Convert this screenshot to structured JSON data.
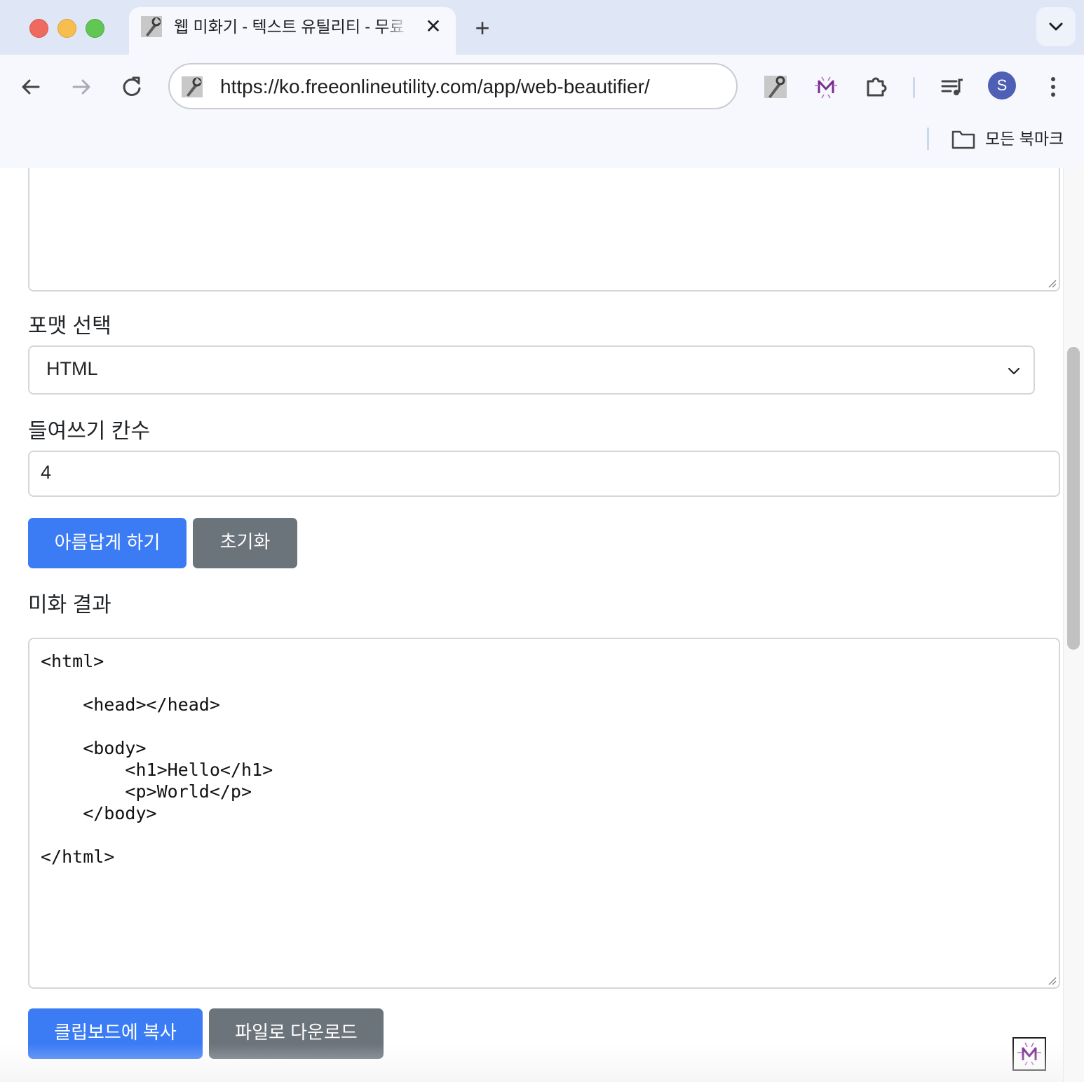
{
  "browser": {
    "tab": {
      "title": "웹 미화기 - 텍스트 유틸리티 - 무료",
      "close_glyph": "✕",
      "favicon_icon": "wrench-icon"
    },
    "new_tab_glyph": "+",
    "address_bar": {
      "url": "https://ko.freeonlineutility.com/app/web-beautifier/"
    },
    "profile_initial": "S",
    "bookmarks_bar": {
      "all_bookmarks_label": "모든 북마크"
    },
    "colors": {
      "frame": "#dfe7f6",
      "toolbar": "#f6f8fd",
      "avatar": "#4f5fb5"
    }
  },
  "form": {
    "format_label": "포맷 선택",
    "format_select": {
      "selected": "HTML"
    },
    "indent_label": "들여쓰기 칸수",
    "indent_input": {
      "value": "4"
    },
    "beautify_button": "아름답게 하기",
    "reset_button": "초기화"
  },
  "result": {
    "label": "미화 결과",
    "code": "<html>\n\n    <head></head>\n\n    <body>\n        <h1>Hello</h1>\n        <p>World</p>\n    </body>\n\n</html>",
    "copy_button": "클립보드에 복사",
    "download_button": "파일로 다운로드"
  },
  "theme": {
    "primary": "#3b7cf5",
    "secondary": "#6b737b",
    "text": "#212529",
    "border": "#d3d6da"
  }
}
